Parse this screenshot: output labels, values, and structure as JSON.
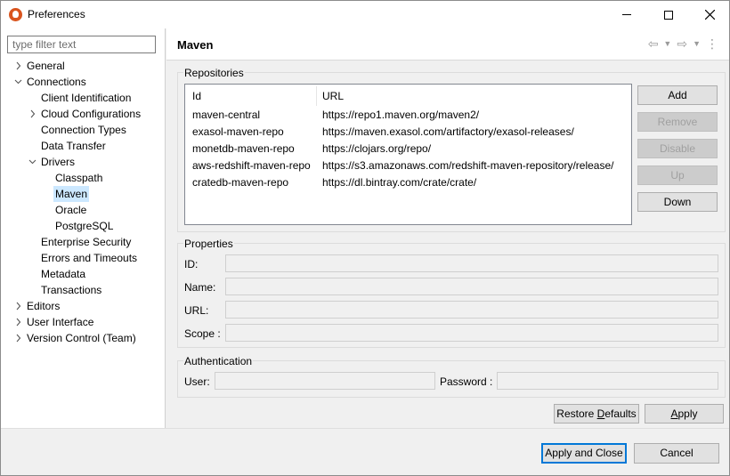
{
  "window": {
    "title": "Preferences"
  },
  "filter": {
    "placeholder": "type filter text"
  },
  "tree": [
    {
      "label": "General",
      "level": 0,
      "expander": "collapsed"
    },
    {
      "label": "Connections",
      "level": 0,
      "expander": "expanded"
    },
    {
      "label": "Client Identification",
      "level": 1,
      "expander": "none"
    },
    {
      "label": "Cloud Configurations",
      "level": 1,
      "expander": "collapsed"
    },
    {
      "label": "Connection Types",
      "level": 1,
      "expander": "none"
    },
    {
      "label": "Data Transfer",
      "level": 1,
      "expander": "none"
    },
    {
      "label": "Drivers",
      "level": 1,
      "expander": "expanded"
    },
    {
      "label": "Classpath",
      "level": 2,
      "expander": "none"
    },
    {
      "label": "Maven",
      "level": 2,
      "expander": "none",
      "selected": true
    },
    {
      "label": "Oracle",
      "level": 2,
      "expander": "none"
    },
    {
      "label": "PostgreSQL",
      "level": 2,
      "expander": "none"
    },
    {
      "label": "Enterprise Security",
      "level": 1,
      "expander": "none"
    },
    {
      "label": "Errors and Timeouts",
      "level": 1,
      "expander": "none"
    },
    {
      "label": "Metadata",
      "level": 1,
      "expander": "none"
    },
    {
      "label": "Transactions",
      "level": 1,
      "expander": "none"
    },
    {
      "label": "Editors",
      "level": 0,
      "expander": "collapsed"
    },
    {
      "label": "User Interface",
      "level": 0,
      "expander": "collapsed"
    },
    {
      "label": "Version Control (Team)",
      "level": 0,
      "expander": "collapsed"
    }
  ],
  "page": {
    "title": "Maven"
  },
  "repositories": {
    "group_label": "Repositories",
    "columns": {
      "id": "Id",
      "url": "URL"
    },
    "rows": [
      {
        "id": "maven-central",
        "url": "https://repo1.maven.org/maven2/"
      },
      {
        "id": "exasol-maven-repo",
        "url": "https://maven.exasol.com/artifactory/exasol-releases/"
      },
      {
        "id": "monetdb-maven-repo",
        "url": "https://clojars.org/repo/"
      },
      {
        "id": "aws-redshift-maven-repo",
        "url": "https://s3.amazonaws.com/redshift-maven-repository/release/"
      },
      {
        "id": "cratedb-maven-repo",
        "url": "https://dl.bintray.com/crate/crate/"
      }
    ],
    "buttons": {
      "add": "Add",
      "remove": "Remove",
      "disable": "Disable",
      "up": "Up",
      "down": "Down"
    }
  },
  "properties": {
    "group_label": "Properties",
    "id_label": "ID:",
    "id_value": "",
    "name_label": "Name:",
    "name_value": "",
    "url_label": "URL:",
    "url_value": "",
    "scope_label": "Scope :",
    "scope_value": ""
  },
  "authentication": {
    "group_label": "Authentication",
    "user_label": "User:",
    "user_value": "",
    "password_label": "Password :",
    "password_value": ""
  },
  "page_buttons": {
    "restore_pre": "Restore ",
    "restore_u": "D",
    "restore_post": "efaults",
    "apply_u": "A",
    "apply_post": "pply"
  },
  "dialog_buttons": {
    "apply_close": "Apply and Close",
    "cancel": "Cancel"
  },
  "colors": {
    "selection": "#cce8ff",
    "primary_border": "#0078d7",
    "app_icon": "#d9541e"
  }
}
